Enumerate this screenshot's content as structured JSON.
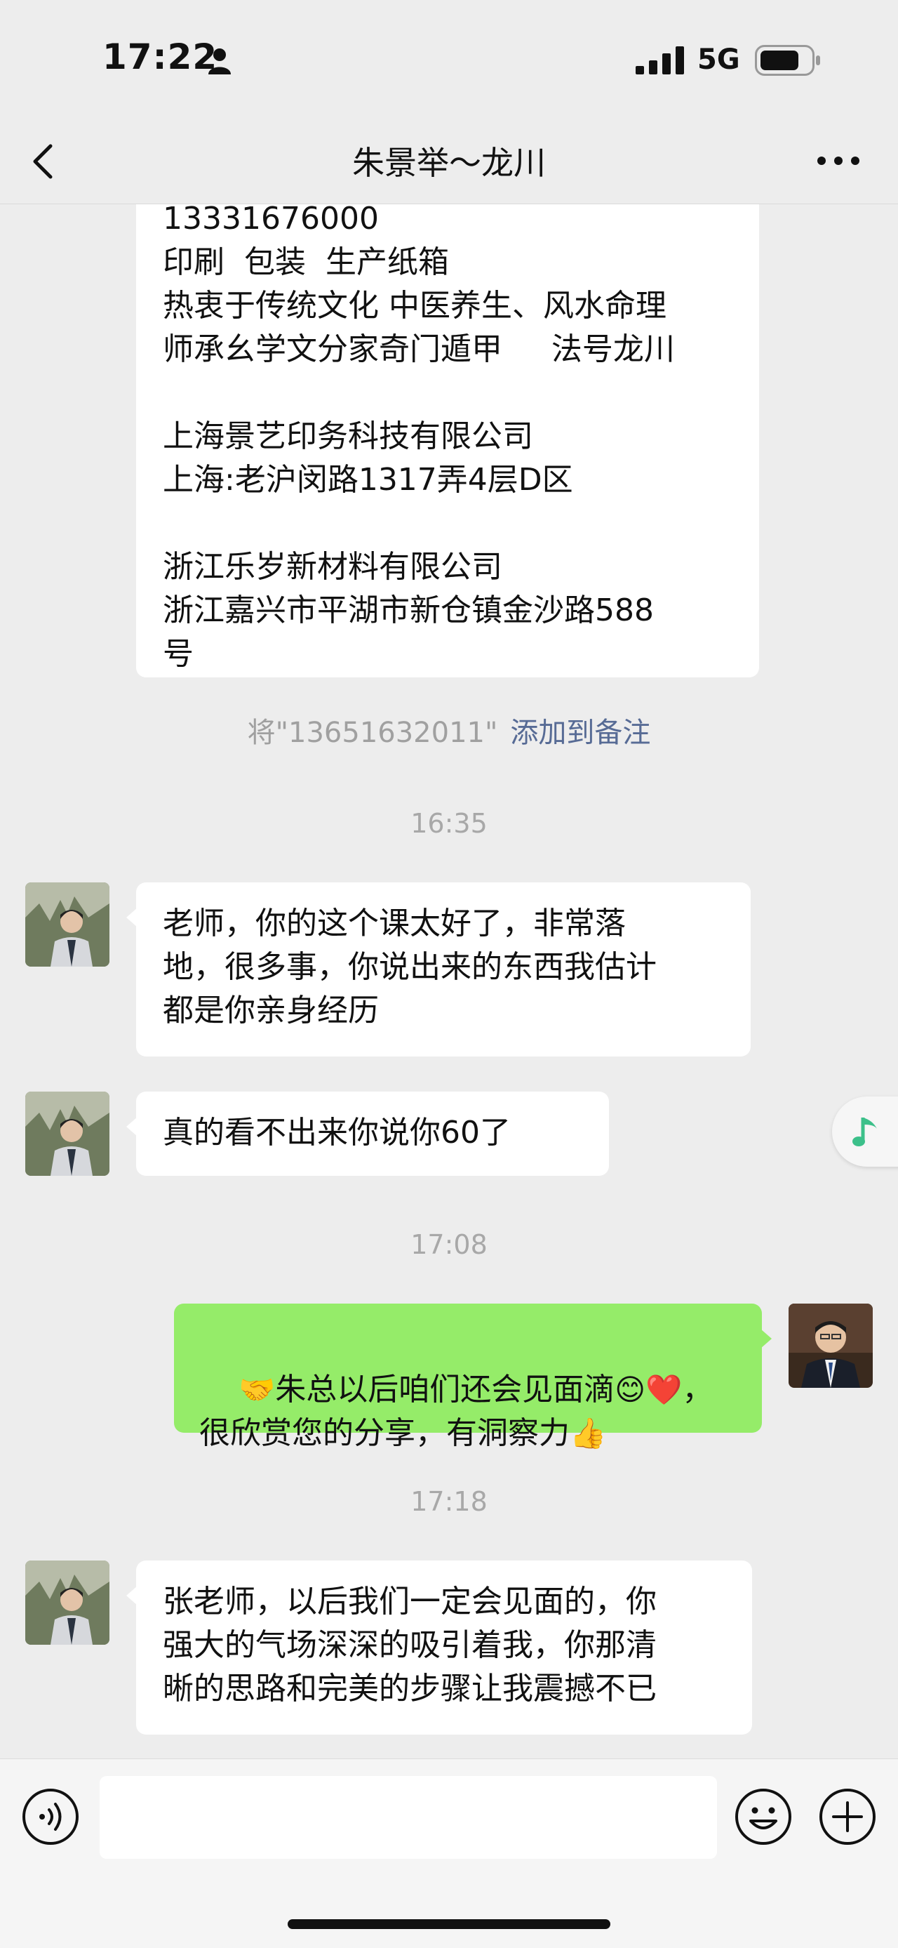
{
  "status_bar": {
    "time": "17:22",
    "network": "5G"
  },
  "nav": {
    "title": "朱景举～龙川"
  },
  "messages": {
    "card_text": "13331676000\n印刷  包装  生产纸箱\n热衷于传统文化 中医养生、风水命理\n师承幺学文分家奇门遁甲     法号龙川\n\n上海景艺印务科技有限公司\n上海:老沪闵路1317弄4层D区\n\n浙江乐岁新材料有限公司\n浙江嘉兴市平湖市新仓镇金沙路588\n号",
    "system_note": {
      "text": "将\"13651632011\"",
      "link": "添加到备注"
    },
    "time1": "16:35",
    "msg1": "老师，你的这个课太好了，非常落\n地，很多事，你说出来的东西我估计\n都是你亲身经历",
    "msg2": "真的看不出来你说你60了",
    "time2": "17:08",
    "my_msg": {
      "emoji_handshake": "🤝",
      "part1": "朱总以后咱们还会见面滴",
      "emoji_smile": "😊",
      "emoji_heart": "❤️",
      "part2": "，\n很欣赏您的分享，有洞察力",
      "emoji_thumb": "👍"
    },
    "time3": "17:18",
    "msg3": "张老师，以后我们一定会见面的，你\n强大的气场深深的吸引着我，你那清\n晰的思路和完美的步骤让我震撼不已"
  },
  "colors": {
    "my_bubble": "#95ec69",
    "link": "#576b95",
    "background": "#ededed"
  }
}
